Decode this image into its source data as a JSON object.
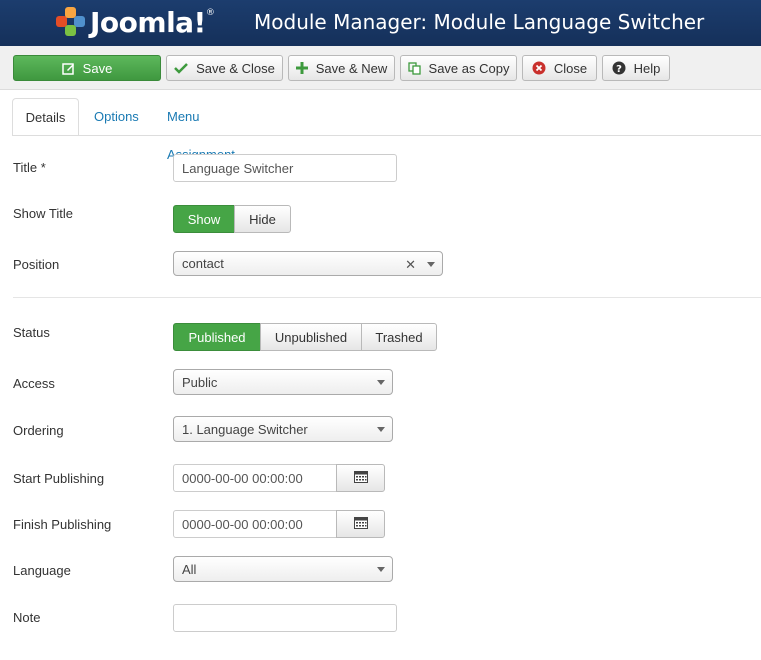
{
  "header": {
    "logo_text": "Joomla!",
    "logo_mark": "®",
    "title": "Module Manager: Module Language Switcher"
  },
  "toolbar": {
    "save": {
      "label": "Save",
      "icon": "edit-icon"
    },
    "save_close": {
      "label": "Save & Close",
      "icon": "check-icon"
    },
    "save_new": {
      "label": "Save & New",
      "icon": "plus-icon"
    },
    "save_copy": {
      "label": "Save as Copy",
      "icon": "copy-icon"
    },
    "close": {
      "label": "Close",
      "icon": "close-circle-icon"
    },
    "help": {
      "label": "Help",
      "icon": "question-icon"
    }
  },
  "tabs": [
    {
      "label": "Details",
      "active": true
    },
    {
      "label": "Options",
      "active": false
    },
    {
      "label": "Menu Assignment",
      "active": false
    }
  ],
  "form": {
    "title": {
      "label": "Title *",
      "value": "Language Switcher"
    },
    "show_title": {
      "label": "Show Title",
      "options": [
        "Show",
        "Hide"
      ],
      "selected": "Show"
    },
    "position": {
      "label": "Position",
      "value": "contact"
    },
    "status": {
      "label": "Status",
      "options": [
        "Published",
        "Unpublished",
        "Trashed"
      ],
      "selected": "Published"
    },
    "access": {
      "label": "Access",
      "value": "Public"
    },
    "ordering": {
      "label": "Ordering",
      "value": "1. Language Switcher"
    },
    "start_publishing": {
      "label": "Start Publishing",
      "value": "0000-00-00 00:00:00"
    },
    "finish_publishing": {
      "label": "Finish Publishing",
      "value": "0000-00-00 00:00:00"
    },
    "language": {
      "label": "Language",
      "value": "All"
    },
    "note": {
      "label": "Note",
      "value": ""
    }
  },
  "colors": {
    "header_bg": "#1c3d6e",
    "primary_green": "#46a546",
    "link_blue": "#1a7ab3"
  }
}
